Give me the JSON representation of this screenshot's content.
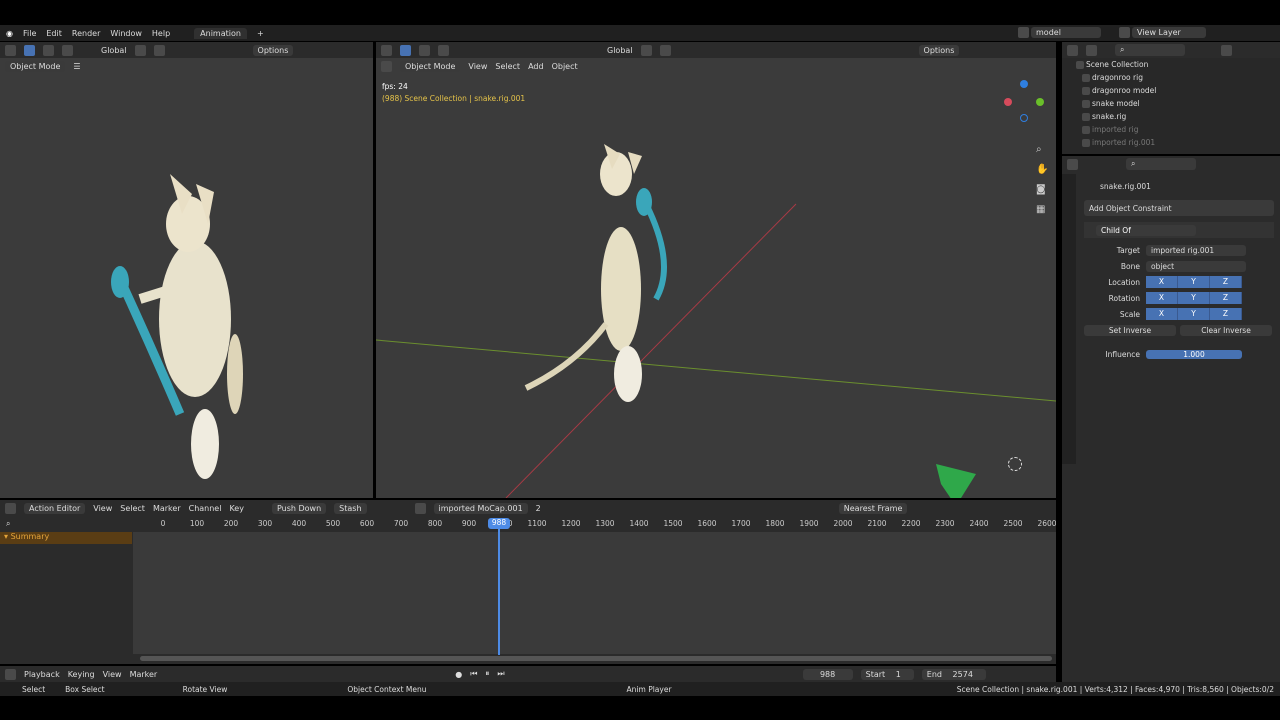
{
  "topmenu": {
    "items": [
      "File",
      "Edit",
      "Render",
      "Window",
      "Help"
    ],
    "workspace_tab": "Animation",
    "add_tab": "+",
    "scene": "model",
    "view_layer": "View Layer"
  },
  "left_viewport": {
    "global": "Global",
    "options": "Options",
    "mode": "Object Mode"
  },
  "main_viewport": {
    "global": "Global",
    "options": "Options",
    "mode": "Object Mode",
    "menus": [
      "View",
      "Select",
      "Add",
      "Object"
    ],
    "fps": "fps: 24",
    "context": "(988) Scene Collection | snake.rig.001"
  },
  "outliner": {
    "root": "Scene Collection",
    "items": [
      {
        "label": "dragonroo rig",
        "dim": false
      },
      {
        "label": "dragonroo model",
        "dim": false
      },
      {
        "label": "snake model",
        "dim": false
      },
      {
        "label": "snake.rig",
        "dim": false
      },
      {
        "label": "imported rig",
        "dim": true
      },
      {
        "label": "imported rig.001",
        "dim": true
      }
    ]
  },
  "properties": {
    "object_name": "snake.rig.001",
    "add_constraint": "Add Object Constraint",
    "constraint_name": "Child Of",
    "target_label": "Target",
    "target_value": "imported rig.001",
    "bone_label": "Bone",
    "bone_value": "object",
    "location_label": "Location",
    "rotation_label": "Rotation",
    "scale_label": "Scale",
    "axes": [
      "X",
      "Y",
      "Z"
    ],
    "set_inverse": "Set Inverse",
    "clear_inverse": "Clear Inverse",
    "influence_label": "Influence",
    "influence_value": "1.000"
  },
  "action_editor": {
    "mode": "Action Editor",
    "menus": [
      "View",
      "Select",
      "Marker",
      "Channel",
      "Key"
    ],
    "push_down": "Push Down",
    "stash": "Stash",
    "action": "imported MoCap.001",
    "users": "2",
    "snap": "Nearest Frame",
    "summary": "Summary",
    "ruler": [
      "0",
      "100",
      "200",
      "300",
      "400",
      "500",
      "600",
      "700",
      "800",
      "900",
      "1000",
      "1100",
      "1200",
      "1300",
      "1400",
      "1500",
      "1600",
      "1700",
      "1800",
      "1900",
      "2000",
      "2100",
      "2200",
      "2300",
      "2400",
      "2500",
      "2600"
    ],
    "current_frame": "988"
  },
  "timeline": {
    "menus": [
      "Playback",
      "Keying",
      "View",
      "Marker"
    ],
    "frame": "988",
    "start_label": "Start",
    "start_value": "1",
    "end_label": "End",
    "end_value": "2574"
  },
  "statusbar": {
    "select": "Select",
    "box_select": "Box Select",
    "rotate_view": "Rotate View",
    "context_menu": "Object Context Menu",
    "anim_player": "Anim Player",
    "stats": "Scene Collection | snake.rig.001 | Verts:4,312 | Faces:4,970 | Tris:8,560 | Objects:0/2"
  },
  "colors": {
    "accent": "#4772b3",
    "playhead": "#4d8be6",
    "bg_panel": "#2b2b2b",
    "viewport": "#3b3b3b"
  }
}
